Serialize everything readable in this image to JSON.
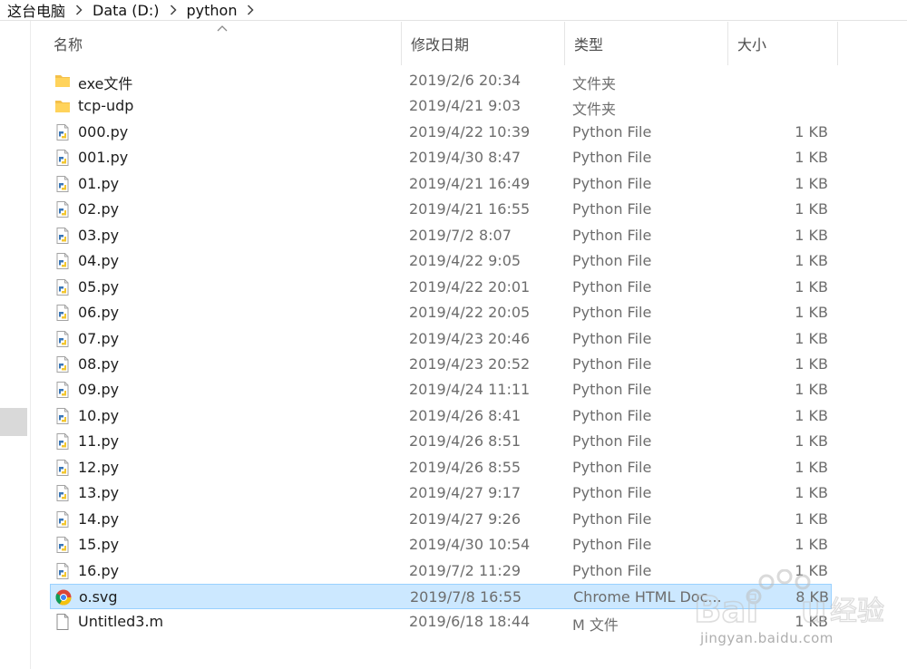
{
  "breadcrumb": [
    "这台电脑",
    "Data (D:)",
    "python"
  ],
  "columns": {
    "name": "名称",
    "date": "修改日期",
    "type": "类型",
    "size": "大小"
  },
  "files": [
    {
      "name": "exe文件",
      "date": "2019/2/6 20:34",
      "type": "文件夹",
      "size": "",
      "icon": "folder-icon"
    },
    {
      "name": "tcp-udp",
      "date": "2019/4/21 9:03",
      "type": "文件夹",
      "size": "",
      "icon": "folder-icon"
    },
    {
      "name": "000.py",
      "date": "2019/4/22 10:39",
      "type": "Python File",
      "size": "1 KB",
      "icon": "python-file-icon"
    },
    {
      "name": "001.py",
      "date": "2019/4/30 8:47",
      "type": "Python File",
      "size": "1 KB",
      "icon": "python-file-icon"
    },
    {
      "name": "01.py",
      "date": "2019/4/21 16:49",
      "type": "Python File",
      "size": "1 KB",
      "icon": "python-file-icon"
    },
    {
      "name": "02.py",
      "date": "2019/4/21 16:55",
      "type": "Python File",
      "size": "1 KB",
      "icon": "python-file-icon"
    },
    {
      "name": "03.py",
      "date": "2019/7/2 8:07",
      "type": "Python File",
      "size": "1 KB",
      "icon": "python-file-icon"
    },
    {
      "name": "04.py",
      "date": "2019/4/22 9:05",
      "type": "Python File",
      "size": "1 KB",
      "icon": "python-file-icon"
    },
    {
      "name": "05.py",
      "date": "2019/4/22 20:01",
      "type": "Python File",
      "size": "1 KB",
      "icon": "python-file-icon"
    },
    {
      "name": "06.py",
      "date": "2019/4/22 20:05",
      "type": "Python File",
      "size": "1 KB",
      "icon": "python-file-icon"
    },
    {
      "name": "07.py",
      "date": "2019/4/23 20:46",
      "type": "Python File",
      "size": "1 KB",
      "icon": "python-file-icon"
    },
    {
      "name": "08.py",
      "date": "2019/4/23 20:52",
      "type": "Python File",
      "size": "1 KB",
      "icon": "python-file-icon"
    },
    {
      "name": "09.py",
      "date": "2019/4/24 11:11",
      "type": "Python File",
      "size": "1 KB",
      "icon": "python-file-icon"
    },
    {
      "name": "10.py",
      "date": "2019/4/26 8:41",
      "type": "Python File",
      "size": "1 KB",
      "icon": "python-file-icon"
    },
    {
      "name": "11.py",
      "date": "2019/4/26 8:51",
      "type": "Python File",
      "size": "1 KB",
      "icon": "python-file-icon"
    },
    {
      "name": "12.py",
      "date": "2019/4/26 8:55",
      "type": "Python File",
      "size": "1 KB",
      "icon": "python-file-icon"
    },
    {
      "name": "13.py",
      "date": "2019/4/27 9:17",
      "type": "Python File",
      "size": "1 KB",
      "icon": "python-file-icon"
    },
    {
      "name": "14.py",
      "date": "2019/4/27 9:26",
      "type": "Python File",
      "size": "1 KB",
      "icon": "python-file-icon"
    },
    {
      "name": "15.py",
      "date": "2019/4/30 10:54",
      "type": "Python File",
      "size": "1 KB",
      "icon": "python-file-icon"
    },
    {
      "name": "16.py",
      "date": "2019/7/2 11:29",
      "type": "Python File",
      "size": "1 KB",
      "icon": "python-file-icon"
    },
    {
      "name": "o.svg",
      "date": "2019/7/8 16:55",
      "type": "Chrome HTML Doc...",
      "size": "8 KB",
      "icon": "chrome-file-icon",
      "selected": true
    },
    {
      "name": "Untitled3.m",
      "date": "2019/6/18 18:44",
      "type": "M 文件",
      "size": "1 KB",
      "icon": "blank-file-icon"
    }
  ],
  "watermark": {
    "logo": "Baidu经验",
    "url": "jingyan.baidu.com"
  },
  "colors": {
    "selection_bg": "#cce8ff",
    "selection_border": "#99d1ff",
    "folder": "#f4c04a",
    "python_blue": "#3b77b7",
    "python_yellow": "#f2c631"
  }
}
